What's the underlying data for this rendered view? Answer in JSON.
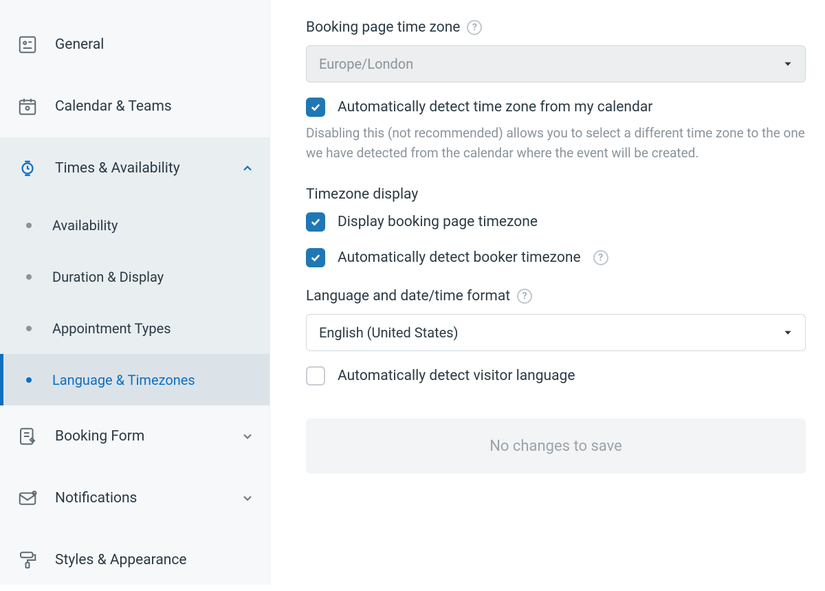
{
  "sidebar": {
    "items": [
      {
        "label": "General"
      },
      {
        "label": "Calendar & Teams"
      },
      {
        "label": "Times & Availability",
        "expanded": true
      },
      {
        "label": "Booking Form"
      },
      {
        "label": "Notifications"
      },
      {
        "label": "Styles & Appearance"
      }
    ],
    "subItems": [
      {
        "label": "Availability"
      },
      {
        "label": "Duration & Display"
      },
      {
        "label": "Appointment Types"
      },
      {
        "label": "Language & Timezones",
        "active": true
      }
    ]
  },
  "main": {
    "timezoneLabel": "Booking page time zone",
    "timezoneValue": "Europe/London",
    "autoDetectTz": "Automatically detect time zone from my calendar",
    "autoDetectHint": "Disabling this (not recommended) allows you to select a different time zone to the one we have detected from the calendar where the event will be created.",
    "tzDisplayLabel": "Timezone display",
    "displayBookingTz": "Display booking page timezone",
    "autoDetectBooker": "Automatically detect booker timezone",
    "langLabel": "Language and date/time format",
    "langValue": "English (United States)",
    "autoDetectLang": "Automatically detect visitor language",
    "saveStatus": "No changes to save"
  }
}
